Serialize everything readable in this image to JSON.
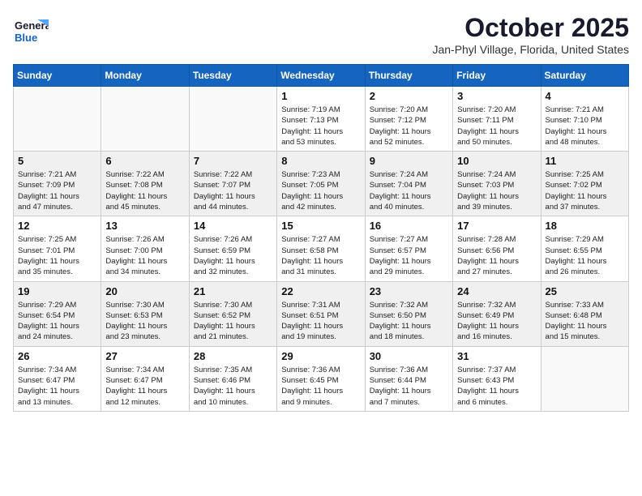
{
  "header": {
    "logo_line1": "General",
    "logo_line2": "Blue",
    "month": "October 2025",
    "location": "Jan-Phyl Village, Florida, United States"
  },
  "weekdays": [
    "Sunday",
    "Monday",
    "Tuesday",
    "Wednesday",
    "Thursday",
    "Friday",
    "Saturday"
  ],
  "weeks": [
    [
      {
        "day": "",
        "info": ""
      },
      {
        "day": "",
        "info": ""
      },
      {
        "day": "",
        "info": ""
      },
      {
        "day": "1",
        "info": "Sunrise: 7:19 AM\nSunset: 7:13 PM\nDaylight: 11 hours\nand 53 minutes."
      },
      {
        "day": "2",
        "info": "Sunrise: 7:20 AM\nSunset: 7:12 PM\nDaylight: 11 hours\nand 52 minutes."
      },
      {
        "day": "3",
        "info": "Sunrise: 7:20 AM\nSunset: 7:11 PM\nDaylight: 11 hours\nand 50 minutes."
      },
      {
        "day": "4",
        "info": "Sunrise: 7:21 AM\nSunset: 7:10 PM\nDaylight: 11 hours\nand 48 minutes."
      }
    ],
    [
      {
        "day": "5",
        "info": "Sunrise: 7:21 AM\nSunset: 7:09 PM\nDaylight: 11 hours\nand 47 minutes."
      },
      {
        "day": "6",
        "info": "Sunrise: 7:22 AM\nSunset: 7:08 PM\nDaylight: 11 hours\nand 45 minutes."
      },
      {
        "day": "7",
        "info": "Sunrise: 7:22 AM\nSunset: 7:07 PM\nDaylight: 11 hours\nand 44 minutes."
      },
      {
        "day": "8",
        "info": "Sunrise: 7:23 AM\nSunset: 7:05 PM\nDaylight: 11 hours\nand 42 minutes."
      },
      {
        "day": "9",
        "info": "Sunrise: 7:24 AM\nSunset: 7:04 PM\nDaylight: 11 hours\nand 40 minutes."
      },
      {
        "day": "10",
        "info": "Sunrise: 7:24 AM\nSunset: 7:03 PM\nDaylight: 11 hours\nand 39 minutes."
      },
      {
        "day": "11",
        "info": "Sunrise: 7:25 AM\nSunset: 7:02 PM\nDaylight: 11 hours\nand 37 minutes."
      }
    ],
    [
      {
        "day": "12",
        "info": "Sunrise: 7:25 AM\nSunset: 7:01 PM\nDaylight: 11 hours\nand 35 minutes."
      },
      {
        "day": "13",
        "info": "Sunrise: 7:26 AM\nSunset: 7:00 PM\nDaylight: 11 hours\nand 34 minutes."
      },
      {
        "day": "14",
        "info": "Sunrise: 7:26 AM\nSunset: 6:59 PM\nDaylight: 11 hours\nand 32 minutes."
      },
      {
        "day": "15",
        "info": "Sunrise: 7:27 AM\nSunset: 6:58 PM\nDaylight: 11 hours\nand 31 minutes."
      },
      {
        "day": "16",
        "info": "Sunrise: 7:27 AM\nSunset: 6:57 PM\nDaylight: 11 hours\nand 29 minutes."
      },
      {
        "day": "17",
        "info": "Sunrise: 7:28 AM\nSunset: 6:56 PM\nDaylight: 11 hours\nand 27 minutes."
      },
      {
        "day": "18",
        "info": "Sunrise: 7:29 AM\nSunset: 6:55 PM\nDaylight: 11 hours\nand 26 minutes."
      }
    ],
    [
      {
        "day": "19",
        "info": "Sunrise: 7:29 AM\nSunset: 6:54 PM\nDaylight: 11 hours\nand 24 minutes."
      },
      {
        "day": "20",
        "info": "Sunrise: 7:30 AM\nSunset: 6:53 PM\nDaylight: 11 hours\nand 23 minutes."
      },
      {
        "day": "21",
        "info": "Sunrise: 7:30 AM\nSunset: 6:52 PM\nDaylight: 11 hours\nand 21 minutes."
      },
      {
        "day": "22",
        "info": "Sunrise: 7:31 AM\nSunset: 6:51 PM\nDaylight: 11 hours\nand 19 minutes."
      },
      {
        "day": "23",
        "info": "Sunrise: 7:32 AM\nSunset: 6:50 PM\nDaylight: 11 hours\nand 18 minutes."
      },
      {
        "day": "24",
        "info": "Sunrise: 7:32 AM\nSunset: 6:49 PM\nDaylight: 11 hours\nand 16 minutes."
      },
      {
        "day": "25",
        "info": "Sunrise: 7:33 AM\nSunset: 6:48 PM\nDaylight: 11 hours\nand 15 minutes."
      }
    ],
    [
      {
        "day": "26",
        "info": "Sunrise: 7:34 AM\nSunset: 6:47 PM\nDaylight: 11 hours\nand 13 minutes."
      },
      {
        "day": "27",
        "info": "Sunrise: 7:34 AM\nSunset: 6:47 PM\nDaylight: 11 hours\nand 12 minutes."
      },
      {
        "day": "28",
        "info": "Sunrise: 7:35 AM\nSunset: 6:46 PM\nDaylight: 11 hours\nand 10 minutes."
      },
      {
        "day": "29",
        "info": "Sunrise: 7:36 AM\nSunset: 6:45 PM\nDaylight: 11 hours\nand 9 minutes."
      },
      {
        "day": "30",
        "info": "Sunrise: 7:36 AM\nSunset: 6:44 PM\nDaylight: 11 hours\nand 7 minutes."
      },
      {
        "day": "31",
        "info": "Sunrise: 7:37 AM\nSunset: 6:43 PM\nDaylight: 11 hours\nand 6 minutes."
      },
      {
        "day": "",
        "info": ""
      }
    ]
  ]
}
